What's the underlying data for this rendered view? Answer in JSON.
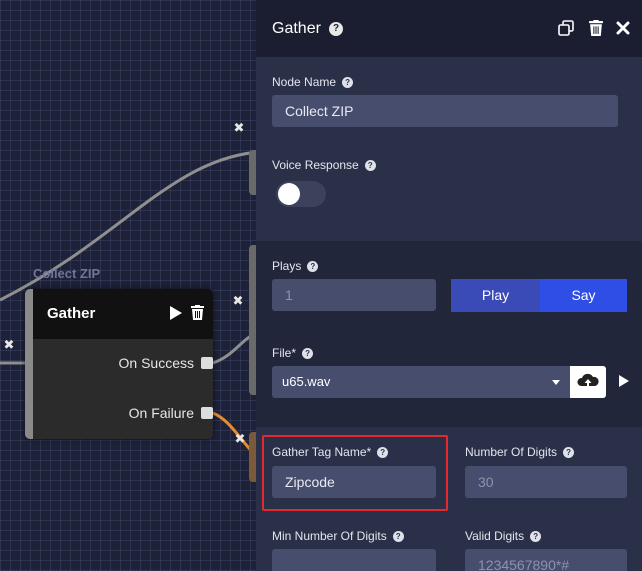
{
  "canvas": {
    "node": {
      "label": "Collect ZIP",
      "title": "Gather",
      "ports": [
        "On Success",
        "On Failure"
      ]
    },
    "delete_marker": "✖"
  },
  "panel": {
    "title": "Gather",
    "node_name": {
      "label": "Node Name",
      "value": "Collect ZIP"
    },
    "voice_response": {
      "label": "Voice Response",
      "enabled": false
    },
    "plays": {
      "label": "Plays",
      "placeholder": "1"
    },
    "play_button": "Play",
    "say_button": "Say",
    "file": {
      "label": "File",
      "required": "*",
      "value": "u65.wav"
    },
    "gather_tag": {
      "label": "Gather Tag Name",
      "required": "*",
      "value": "Zipcode"
    },
    "num_digits": {
      "label": "Number Of Digits",
      "placeholder": "30"
    },
    "min_digits": {
      "label": "Min Number Of Digits",
      "placeholder": ""
    },
    "valid_digits": {
      "label": "Valid Digits",
      "placeholder": "1234567890*#"
    }
  },
  "colors": {
    "canvas_bg": "#1d2238",
    "panel_bg": "#2a2f47",
    "play_btn": "#3a4bb8",
    "say_btn": "#2e4ee5",
    "connector_orange": "#e88a2e",
    "highlight_red": "#e4282c"
  },
  "icons": [
    "help-icon",
    "copy-icon",
    "trash-icon",
    "close-icon",
    "play-icon",
    "cloud-upload-icon",
    "chevron-down-icon"
  ]
}
